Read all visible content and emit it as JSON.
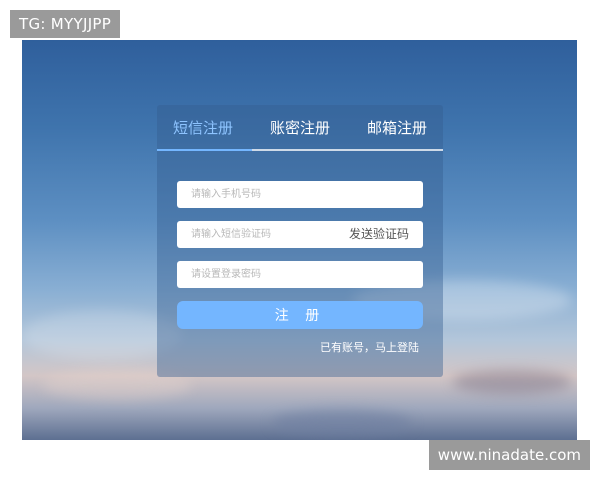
{
  "watermarks": {
    "top_left": "TG: MYYJJPP",
    "bottom_right": "www.ninadate.com"
  },
  "tabs": [
    {
      "label": "短信注册",
      "active": true
    },
    {
      "label": "账密注册",
      "active": false
    },
    {
      "label": "邮箱注册",
      "active": false
    }
  ],
  "form": {
    "phone_placeholder": "请输入手机号码",
    "sms_code_placeholder": "请输入短信验证码",
    "send_code_label": "发送验证码",
    "password_placeholder": "请设置登录密码",
    "submit_label": "注 册",
    "login_link": "已有账号，马上登陆"
  },
  "colors": {
    "accent": "#74b6ff",
    "active_tab": "#8ec4ff"
  }
}
